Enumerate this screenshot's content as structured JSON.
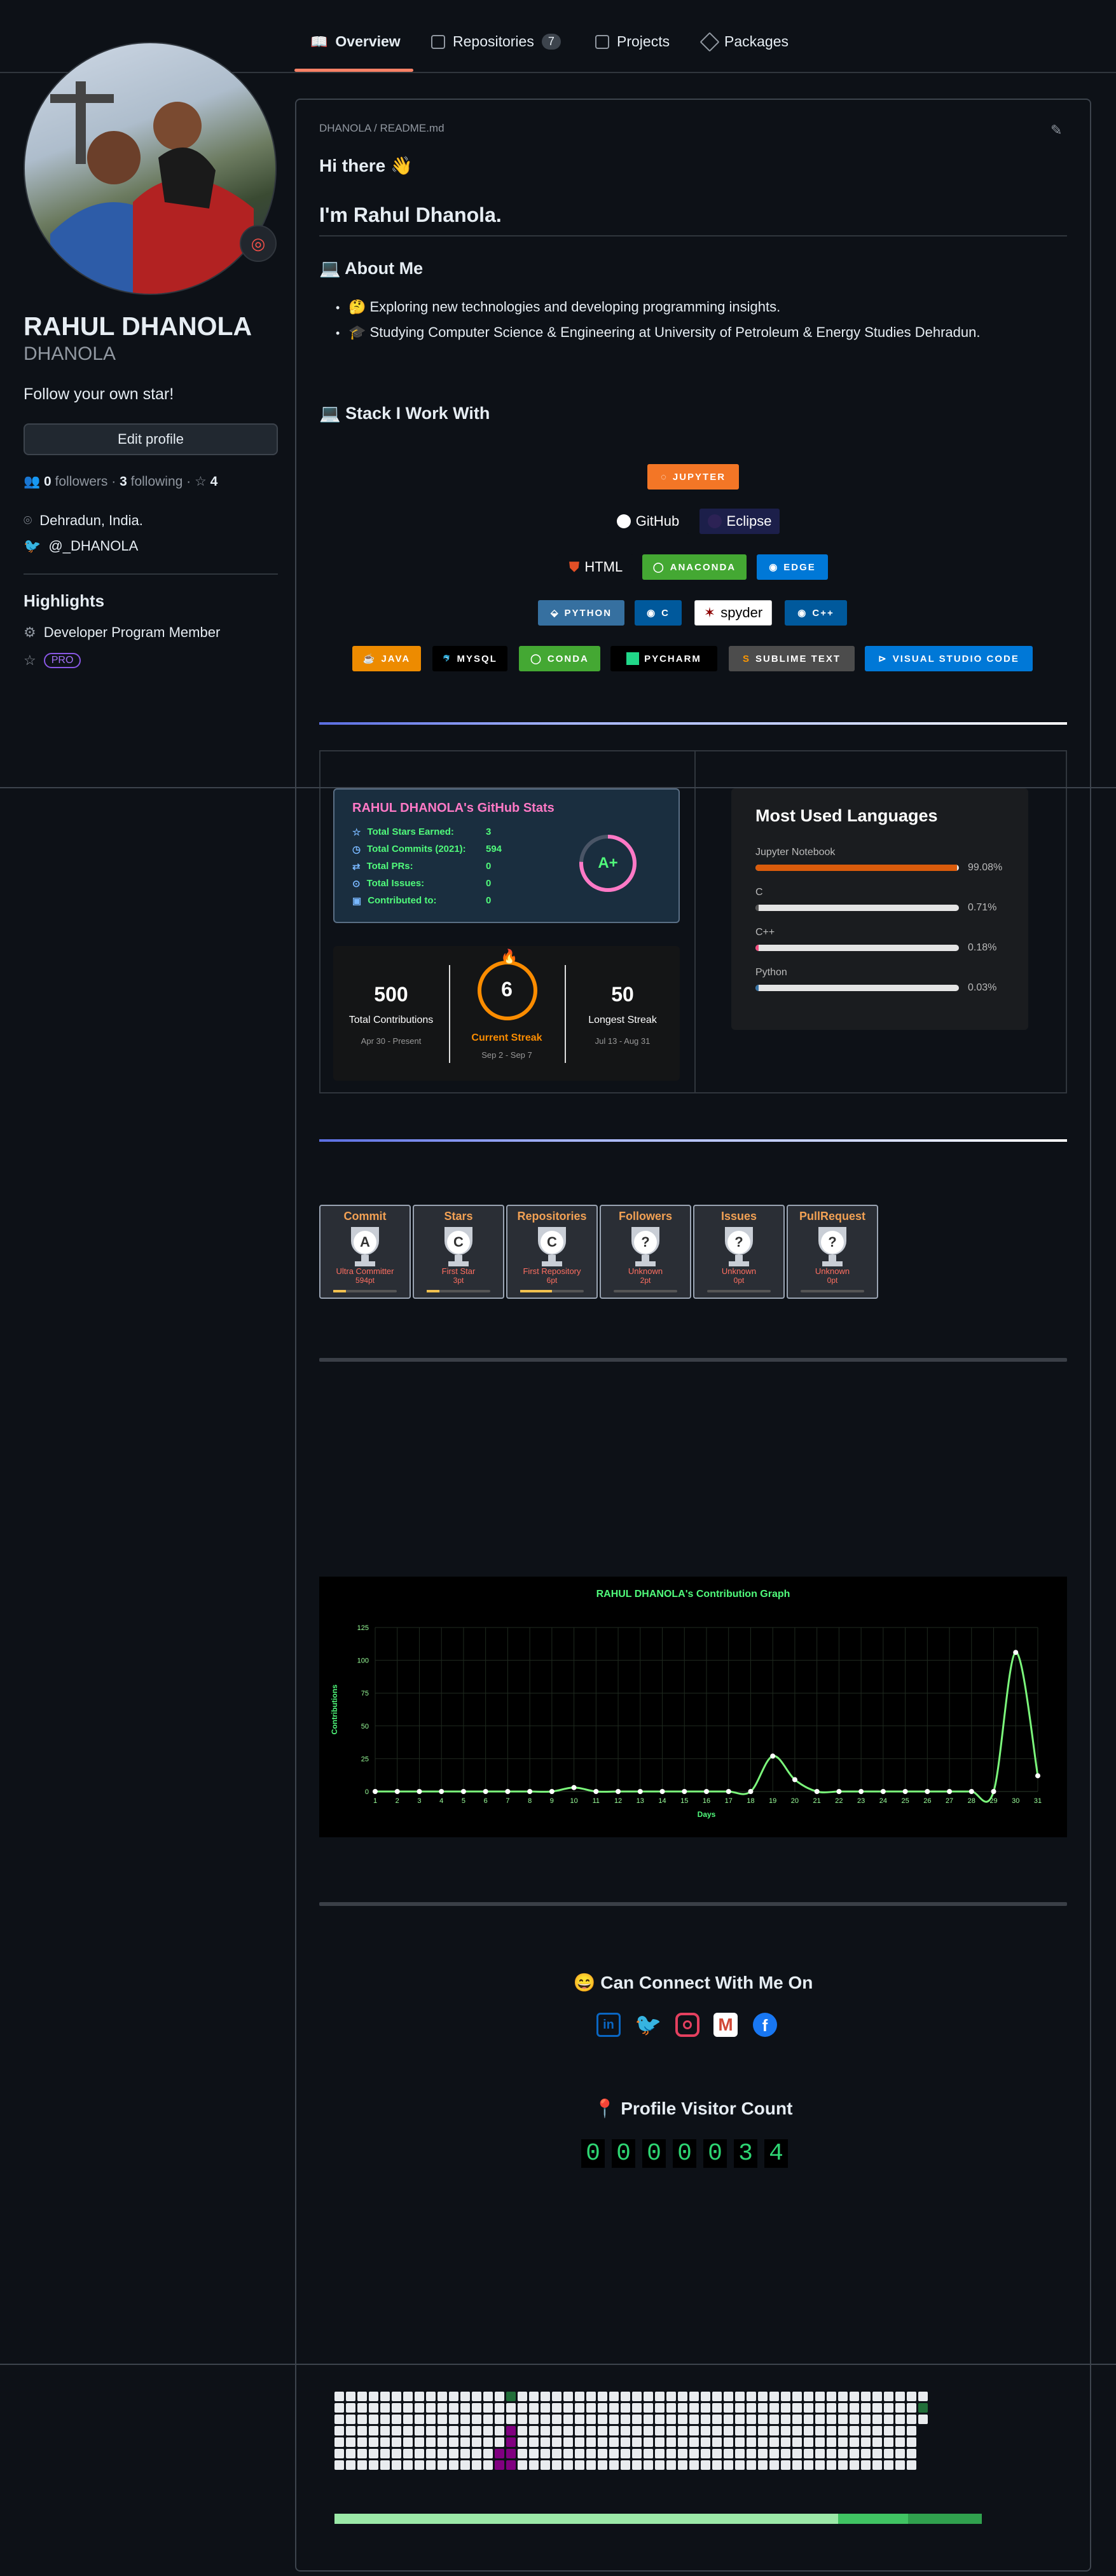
{
  "tabs": [
    {
      "label": "Overview",
      "icon": "book-icon",
      "selected": true
    },
    {
      "label": "Repositories",
      "icon": "repo-icon",
      "count": "7"
    },
    {
      "label": "Projects",
      "icon": "table-icon"
    },
    {
      "label": "Packages",
      "icon": "package-icon"
    }
  ],
  "profile": {
    "name": "RAHUL DHANOLA",
    "login": "DHANOLA",
    "bio": "Follow your own star!",
    "edit_label": "Edit profile",
    "followers_count": "0",
    "followers_label": "followers",
    "following_count": "3",
    "following_label": "following",
    "stars_count": "4",
    "location": "Dehradun, India.",
    "twitter": "@_DHANOLA",
    "highlights_title": "Highlights",
    "highlight_member": "Developer Program Member",
    "pro_label": "PRO"
  },
  "readme": {
    "breadcrumb_user": "DHANOLA",
    "breadcrumb_sep": "/",
    "breadcrumb_file": "README",
    "breadcrumb_ext": ".md",
    "greeting": "Hi there 👋",
    "intro": "I'm Rahul Dhanola.",
    "about_title": "💻 About Me",
    "about_items": [
      "🤔  Exploring new technologies and developing programming insights.",
      "🎓  Studying Computer Science & Engineering at University of Petroleum & Energy Studies Dehradun."
    ],
    "stack_title": "💻 Stack I Work With",
    "badges": [
      {
        "label": "JUPYTER",
        "color": "#F37626"
      },
      {
        "label": "GitHub",
        "color": "#0d1117"
      },
      {
        "label": "Eclipse",
        "color": "#1c1f4a"
      },
      {
        "label": "HTML",
        "color": "#0d1117"
      },
      {
        "label": "ANACONDA",
        "color": "#44A833"
      },
      {
        "label": "EDGE",
        "color": "#0078D7"
      },
      {
        "label": "PYTHON",
        "color": "#3670A0"
      },
      {
        "label": "C",
        "color": "#00599C"
      },
      {
        "label": "spyder",
        "color": "#ffffff"
      },
      {
        "label": "C++",
        "color": "#00599C"
      },
      {
        "label": "JAVA",
        "color": "#ED8B00"
      },
      {
        "label": "MYSQL",
        "color": "#000000"
      },
      {
        "label": "CONDA",
        "color": "#44A833"
      },
      {
        "label": "PYCHARM",
        "color": "#000000"
      },
      {
        "label": "SUBLIME TEXT",
        "color": "#4C4C4C"
      },
      {
        "label": "VISUAL STUDIO CODE",
        "color": "#0078d7"
      }
    ]
  },
  "stats": {
    "title": "RAHUL DHANOLA's GitHub Stats",
    "rows": [
      {
        "label": "Total Stars Earned:",
        "value": "3"
      },
      {
        "label": "Total Commits (2021):",
        "value": "594"
      },
      {
        "label": "Total PRs:",
        "value": "0"
      },
      {
        "label": "Total Issues:",
        "value": "0"
      },
      {
        "label": "Contributed to:",
        "value": "0"
      }
    ],
    "grade": "A+"
  },
  "languages": {
    "title": "Most Used Languages",
    "items": [
      {
        "name": "Jupyter Notebook",
        "pct": "99.08%",
        "fraction": 0.9908,
        "color": "#DA5B0B"
      },
      {
        "name": "C",
        "pct": "0.71%",
        "fraction": 0.0071,
        "color": "#555555"
      },
      {
        "name": "C++",
        "pct": "0.18%",
        "fraction": 0.0018,
        "color": "#f34b7d"
      },
      {
        "name": "Python",
        "pct": "0.03%",
        "fraction": 0.0003,
        "color": "#3572A5"
      }
    ]
  },
  "streak": {
    "total": "500",
    "total_label": "Total Contributions",
    "total_range": "Apr 30 - Present",
    "current": "6",
    "current_label": "Current Streak",
    "current_range": "Sep 2 - Sep 7",
    "longest": "50",
    "longest_label": "Longest Streak",
    "longest_range": "Jul 13 - Aug 31"
  },
  "trophies": [
    {
      "title": "Commit",
      "rank": "A",
      "sub1": "Ultra Committer",
      "sub2": "594pt",
      "progress": 0.2
    },
    {
      "title": "Stars",
      "rank": "C",
      "sub1": "First Star",
      "sub2": "3pt",
      "progress": 0.2
    },
    {
      "title": "Repositories",
      "rank": "C",
      "sub1": "First Repository",
      "sub2": "6pt",
      "progress": 0.5
    },
    {
      "title": "Followers",
      "rank": "?",
      "sub1": "Unknown",
      "sub2": "2pt",
      "progress": 0.0
    },
    {
      "title": "Issues",
      "rank": "?",
      "sub1": "Unknown",
      "sub2": "0pt",
      "progress": 0.0
    },
    {
      "title": "PullRequest",
      "rank": "?",
      "sub1": "Unknown",
      "sub2": "0pt",
      "progress": 0.0
    }
  ],
  "chart_data": {
    "type": "line",
    "title": "RAHUL DHANOLA's Contribution Graph",
    "xlabel": "Days",
    "ylabel": "Contributions",
    "x": [
      1,
      2,
      3,
      4,
      5,
      6,
      7,
      8,
      9,
      10,
      11,
      12,
      13,
      14,
      15,
      16,
      17,
      18,
      19,
      20,
      21,
      22,
      23,
      24,
      25,
      26,
      27,
      28,
      29,
      30,
      31
    ],
    "values": [
      0,
      0,
      0,
      0,
      0,
      0,
      0,
      0,
      0,
      3,
      0,
      0,
      0,
      0,
      0,
      0,
      0,
      0,
      27,
      9,
      0,
      0,
      0,
      0,
      0,
      0,
      0,
      0,
      0,
      106,
      12
    ],
    "ylim": [
      0,
      125
    ],
    "yticks": [
      0,
      25,
      50,
      75,
      100,
      125
    ],
    "grid": true,
    "colors": {
      "line": "#7bf77b",
      "text": "#50fa7b",
      "axis": "#9aff9a",
      "bg": "#000000"
    }
  },
  "connect": {
    "title": "😄 Can Connect With Me On",
    "icons": [
      {
        "name": "linkedin-icon",
        "color": "#0A66C2"
      },
      {
        "name": "twitter-icon",
        "color": "#1DA1F2"
      },
      {
        "name": "instagram-icon",
        "color": "#E4405F"
      },
      {
        "name": "gmail-icon",
        "color": "#D14836"
      },
      {
        "name": "facebook-icon",
        "color": "#1877F2"
      }
    ]
  },
  "visitor": {
    "title": "📍 Profile Visitor Count",
    "digits": [
      "0",
      "0",
      "0",
      "0",
      "0",
      "3",
      "4"
    ]
  }
}
